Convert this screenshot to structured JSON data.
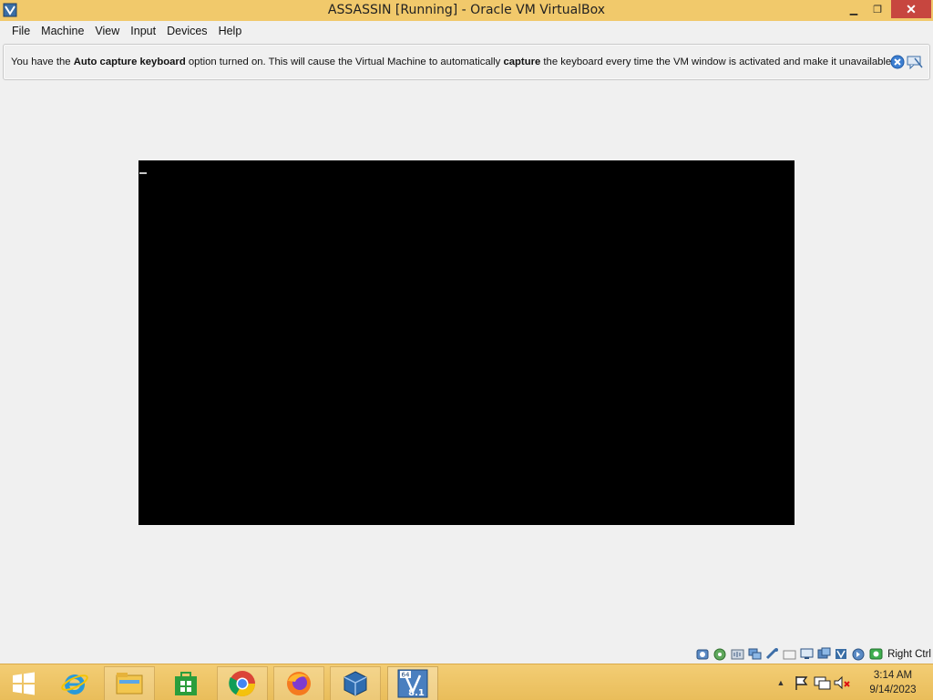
{
  "window": {
    "title": "ASSASSIN [Running] - Oracle VM VirtualBox",
    "app_icon": "virtualbox-icon",
    "controls": [
      "minimize-icon",
      "restore-icon",
      "close-icon"
    ]
  },
  "menu": {
    "items": [
      "File",
      "Machine",
      "View",
      "Input",
      "Devices",
      "Help"
    ]
  },
  "banner": {
    "text_1": "You have the ",
    "bold_1": "Auto capture keyboard",
    "text_2": " option turned on. This will cause the Virtual Machine to automatically ",
    "bold_2": "capture",
    "text_3": " the keyboard every time the VM window is activated and make it unavailable to",
    "close_icon": "close-circle-icon",
    "hide_icon": "do-not-show-icon"
  },
  "statusbar": {
    "icons": [
      "hard-disk-icon",
      "optical-drive-icon",
      "audio-icon",
      "network-icon",
      "usb-icon",
      "shared-folders-icon",
      "display-icon",
      "video-capture-icon",
      "virtualization-icon",
      "mouse-integration-icon",
      "keyboard-capture-icon"
    ],
    "host_key": "Right Ctrl"
  },
  "taskbar": {
    "apps": [
      "start-icon",
      "internet-explorer-icon",
      "file-explorer-icon",
      "store-icon",
      "chrome-icon",
      "firefox-icon",
      "virtualbox-manager-icon",
      "vm-windows-8-1-icon"
    ],
    "vm_badge_top": "64",
    "vm_badge": "8.1",
    "tray_icons": [
      "show-hidden-icons-icon",
      "action-center-flag-icon",
      "network-tray-icon",
      "volume-muted-icon"
    ],
    "time": "3:14 AM",
    "date": "9/14/2023"
  },
  "colors": {
    "titlebar": "#f1c96b",
    "taskbar": "#eec565",
    "close_button": "#c7463f",
    "client_bg": "#f0f0f0",
    "vm_screen": "#000000"
  }
}
